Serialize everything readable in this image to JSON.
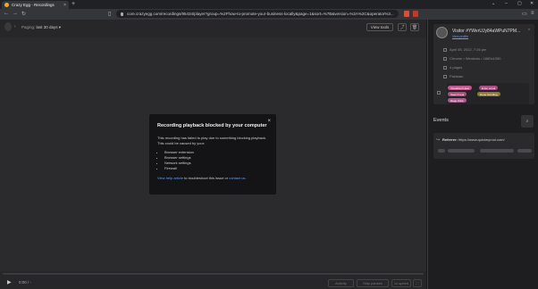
{
  "browser": {
    "tab_title": "Crazy Egg - Recordings",
    "tab_close": "×",
    "new_tab": "+",
    "url": "core.crazyegg.com/recordings/95434/player?group=%2Fhow-to-promote-your-business-locally&page=1&sort=%7B&version=%2A%2C&operator%3..."
  },
  "topbar": {
    "paging_label": "Paging:",
    "paging_value": "last 30 days ▾",
    "view_tools": "View tools"
  },
  "modal": {
    "title": "Recording playback blocked by your computer",
    "close": "×",
    "body": "This recording has failed to play due to something blocking playback. This could be caused by your:",
    "causes": [
      "Browser extension",
      "Browser settings",
      "Network settings",
      "Firewall"
    ],
    "help_link": "View help article",
    "help_mid": " to troubleshoot this issue or ",
    "contact_link": "contact us",
    "help_end": "."
  },
  "bottombar": {
    "time": "0:00 / -",
    "activity": "Activity",
    "skip_pauses": "Skip pauses",
    "speed": "1x speed"
  },
  "visitor": {
    "name": "Visitor #YWerUJy84aWPuN7PM...",
    "link": "View profile",
    "date": "April 05, 2022, 7:26 pm",
    "system": "Chrome • Windows • 1680x1050",
    "pages": "4 pages",
    "country": "Pakistan",
    "tags": [
      "Visualized Heat",
      "Enter email",
      "Search tool",
      "Done Scrolling",
      "Rage Click"
    ]
  },
  "events": {
    "title": "Events",
    "referrer_label": "Referrer:",
    "referrer_value": "https://www.quickeyrool.com/"
  },
  "colors": {
    "tag1": "#c0568d",
    "tag2": "#a94c82",
    "tag3": "#b24a7a",
    "tag4": "#8f7a30",
    "tag5": "#a55a8c",
    "link": "#5aa0ff"
  }
}
